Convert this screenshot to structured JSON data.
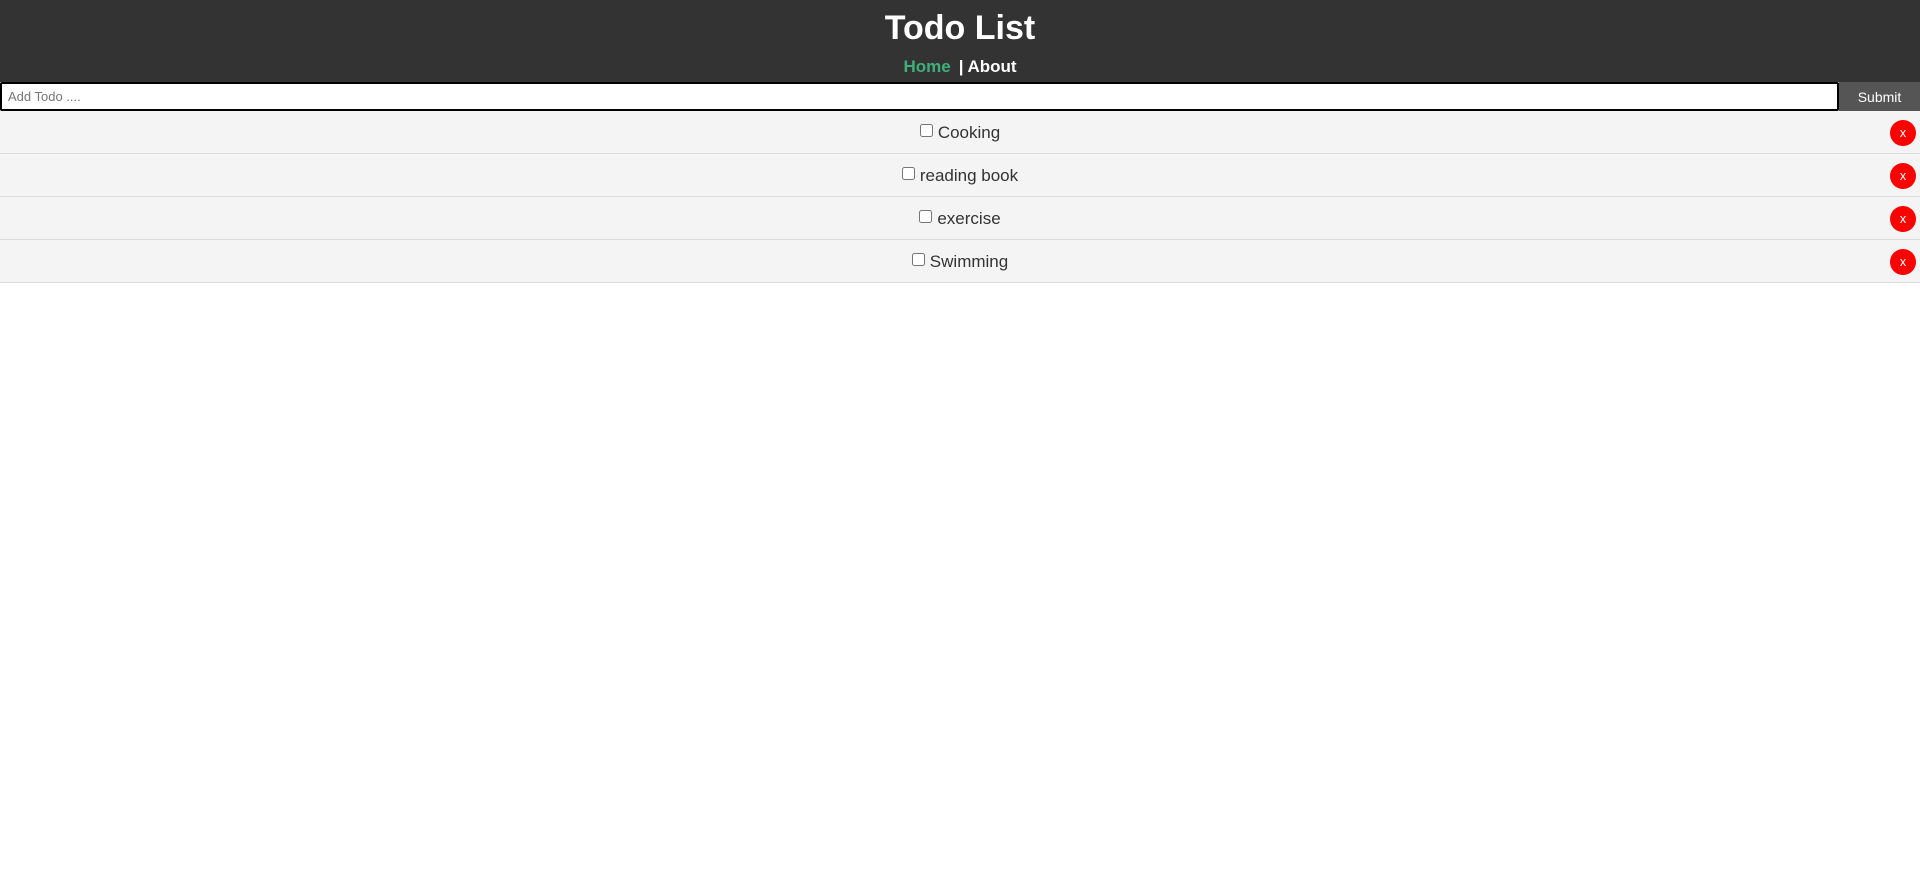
{
  "header": {
    "title": "Todo List",
    "nav": {
      "home": "Home",
      "separator": "|",
      "about": "About"
    }
  },
  "form": {
    "placeholder": "Add Todo ....",
    "value": "",
    "submit_label": "Submit"
  },
  "todos": [
    {
      "title": "Cooking",
      "completed": false,
      "delete_label": "x"
    },
    {
      "title": "reading book",
      "completed": false,
      "delete_label": "x"
    },
    {
      "title": "exercise",
      "completed": false,
      "delete_label": "x"
    },
    {
      "title": "Swimming",
      "completed": false,
      "delete_label": "x"
    }
  ],
  "colors": {
    "header_bg": "#333333",
    "active_link": "#3fb07c",
    "item_bg": "#f4f4f4",
    "delete_bg": "#ff0000",
    "submit_bg": "#555555"
  }
}
